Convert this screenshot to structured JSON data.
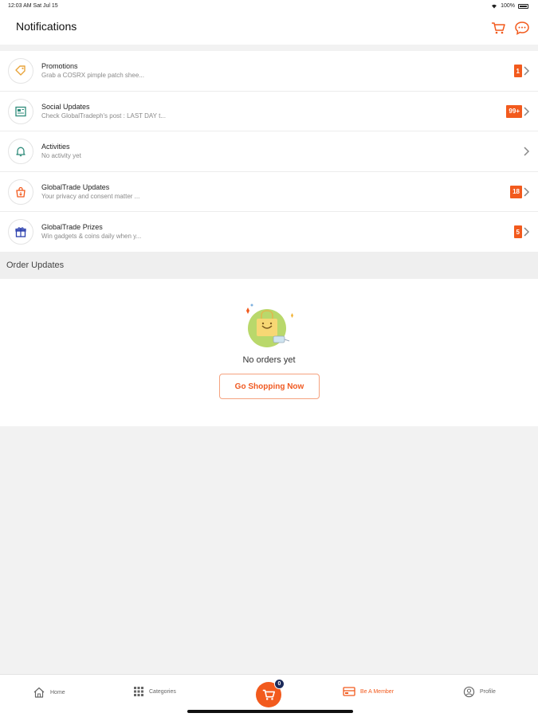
{
  "status_bar": {
    "time_date": "12:03 AM   Sat Jul 15",
    "battery": "100%"
  },
  "header": {
    "title": "Notifications"
  },
  "notifications": [
    {
      "title": "Promotions",
      "subtitle": "Grab a COSRX pimple patch shee...",
      "badge": "1",
      "icon": "tag-icon"
    },
    {
      "title": "Social Updates",
      "subtitle": "Check GlobalTradeph's post : LAST DAY t...",
      "badge": "99+",
      "icon": "newspaper-icon"
    },
    {
      "title": "Activities",
      "subtitle": "No activity yet",
      "badge": "",
      "icon": "bell-icon"
    },
    {
      "title": "GlobalTrade Updates",
      "subtitle": "Your privacy and consent matter ...",
      "badge": "18",
      "icon": "shopping-bag-icon"
    },
    {
      "title": "GlobalTrade Prizes",
      "subtitle": "Win gadgets & coins daily when y...",
      "badge": "5",
      "icon": "gift-icon"
    }
  ],
  "order_updates": {
    "heading": "Order Updates",
    "empty_text": "No orders yet",
    "button_label": "Go Shopping Now"
  },
  "tab_bar": {
    "home": "Home",
    "categories": "Categories",
    "cart_count": "0",
    "member": "Be A Member",
    "profile": "Profile"
  },
  "colors": {
    "accent": "#f25a1d",
    "badge_text": "#ffffff",
    "cart_count_bg": "#1b2a5a"
  }
}
